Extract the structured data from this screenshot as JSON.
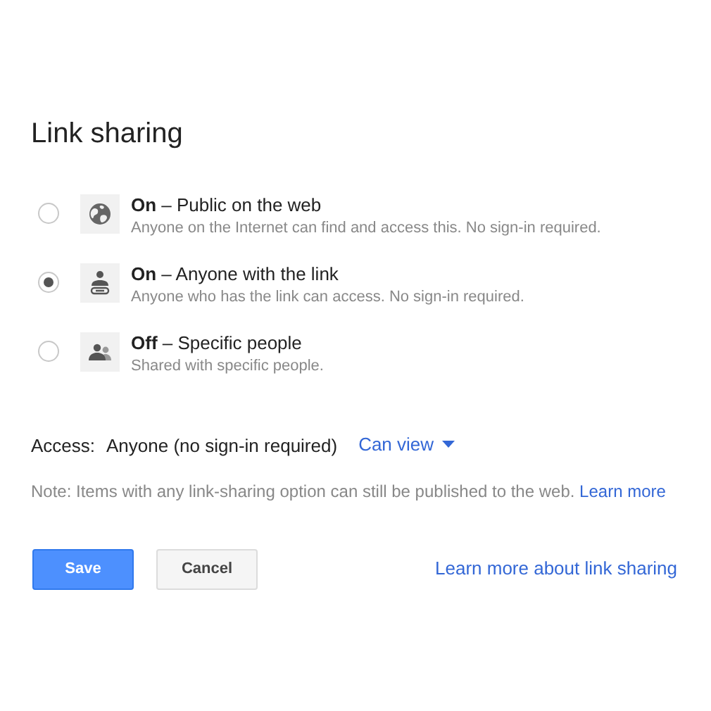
{
  "title": "Link sharing",
  "options": [
    {
      "kind": "globe",
      "selected": false,
      "label": "**On** – Public on the web",
      "description": "Anyone on the Internet can find and access this. No sign-in required."
    },
    {
      "kind": "link",
      "selected": true,
      "label": "**On** – Anyone with the link",
      "description": "Anyone who has the link can access. No sign-in required."
    },
    {
      "kind": "people",
      "selected": false,
      "label": "**Off** – Specific people",
      "description": "Shared with specific people."
    }
  ],
  "access": {
    "label": "Access:",
    "value": "Anyone (no sign-in required)",
    "permission": "Can view"
  },
  "note": {
    "text": "Note: Items with any link-sharing option can still be published to the web.",
    "link": "Learn more"
  },
  "buttons": {
    "save": "Save",
    "cancel": "Cancel"
  },
  "help_link": "Learn more about link sharing"
}
